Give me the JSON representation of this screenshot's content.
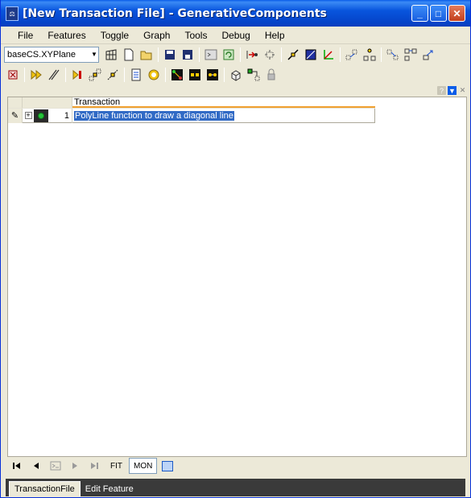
{
  "window": {
    "title": "[New Transaction File] - GenerativeComponents",
    "app_icon_glyph": "⚖",
    "minimize_glyph": "_",
    "maximize_glyph": "□",
    "close_glyph": "✕"
  },
  "menu": [
    "File",
    "Features",
    "Toggle",
    "Graph",
    "Tools",
    "Debug",
    "Help"
  ],
  "toolbar": {
    "plane_value": "baseCS.XYPlane",
    "icons_row1": [
      "grid-icon",
      "new-file-icon",
      "open-folder-icon",
      "save-icon",
      "save-all-icon",
      "script-icon",
      "refresh-icon",
      "step-into-icon",
      "step-out-icon",
      "point-icon",
      "rectangle-icon",
      "axes-icon",
      "node-up-icon",
      "node-branch-icon",
      "node-down-icon",
      "node-split-icon",
      "node-link-icon"
    ],
    "icons_row2": [
      "stop-icon",
      "fast-forward-icon",
      "lines-icon",
      "play-marker-icon",
      "points-grid-icon",
      "diagonal-icon",
      "document-icon",
      "record-icon",
      "graph-a-icon",
      "graph-b-icon",
      "graph-c-icon",
      "cube-icon",
      "snap-icon",
      "lock-icon"
    ]
  },
  "dock": {
    "help_glyph": "?",
    "menu_glyph": "▼",
    "close_glyph": "✕"
  },
  "grid": {
    "column_header": "Transaction",
    "rows": [
      {
        "number": "1",
        "text": "PolyLine function to draw a diagonal line",
        "status_color": "#27c43a"
      }
    ]
  },
  "navbar": {
    "fit_label": "FIT",
    "mon_label": "MON"
  },
  "tabs": [
    "TransactionFile",
    "Edit Feature"
  ]
}
